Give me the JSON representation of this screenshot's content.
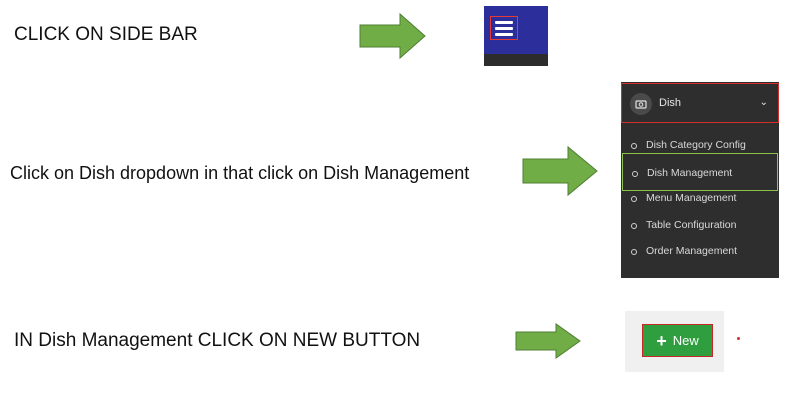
{
  "colors": {
    "arrow_green": "#70ad47",
    "arrow_outline": "#507e32",
    "navbar_blue": "#2b2e9b",
    "sidebar_bg": "#2e2e2e",
    "highlight_red": "#d32f2f",
    "highlight_green": "#8bc34a",
    "button_green": "#2e9e3e"
  },
  "steps": [
    {
      "text": "CLICK ON SIDE BAR"
    },
    {
      "text": "Click on Dish dropdown in that click on Dish Management"
    },
    {
      "text": "IN Dish Management CLICK ON NEW BUTTON"
    }
  ],
  "hamburger": {
    "icon": "hamburger-menu-icon"
  },
  "sidebar": {
    "header": {
      "icon": "dish-icon",
      "label": "Dish",
      "chevron": "⌄"
    },
    "items": [
      {
        "label": "Dish Category Config"
      },
      {
        "label": "Dish Management",
        "active": true
      },
      {
        "label": "Menu Management"
      },
      {
        "label": "Table Configuration"
      },
      {
        "label": "Order Management"
      }
    ]
  },
  "new_button": {
    "icon": "plus-icon",
    "plus": "+",
    "label": "New"
  }
}
